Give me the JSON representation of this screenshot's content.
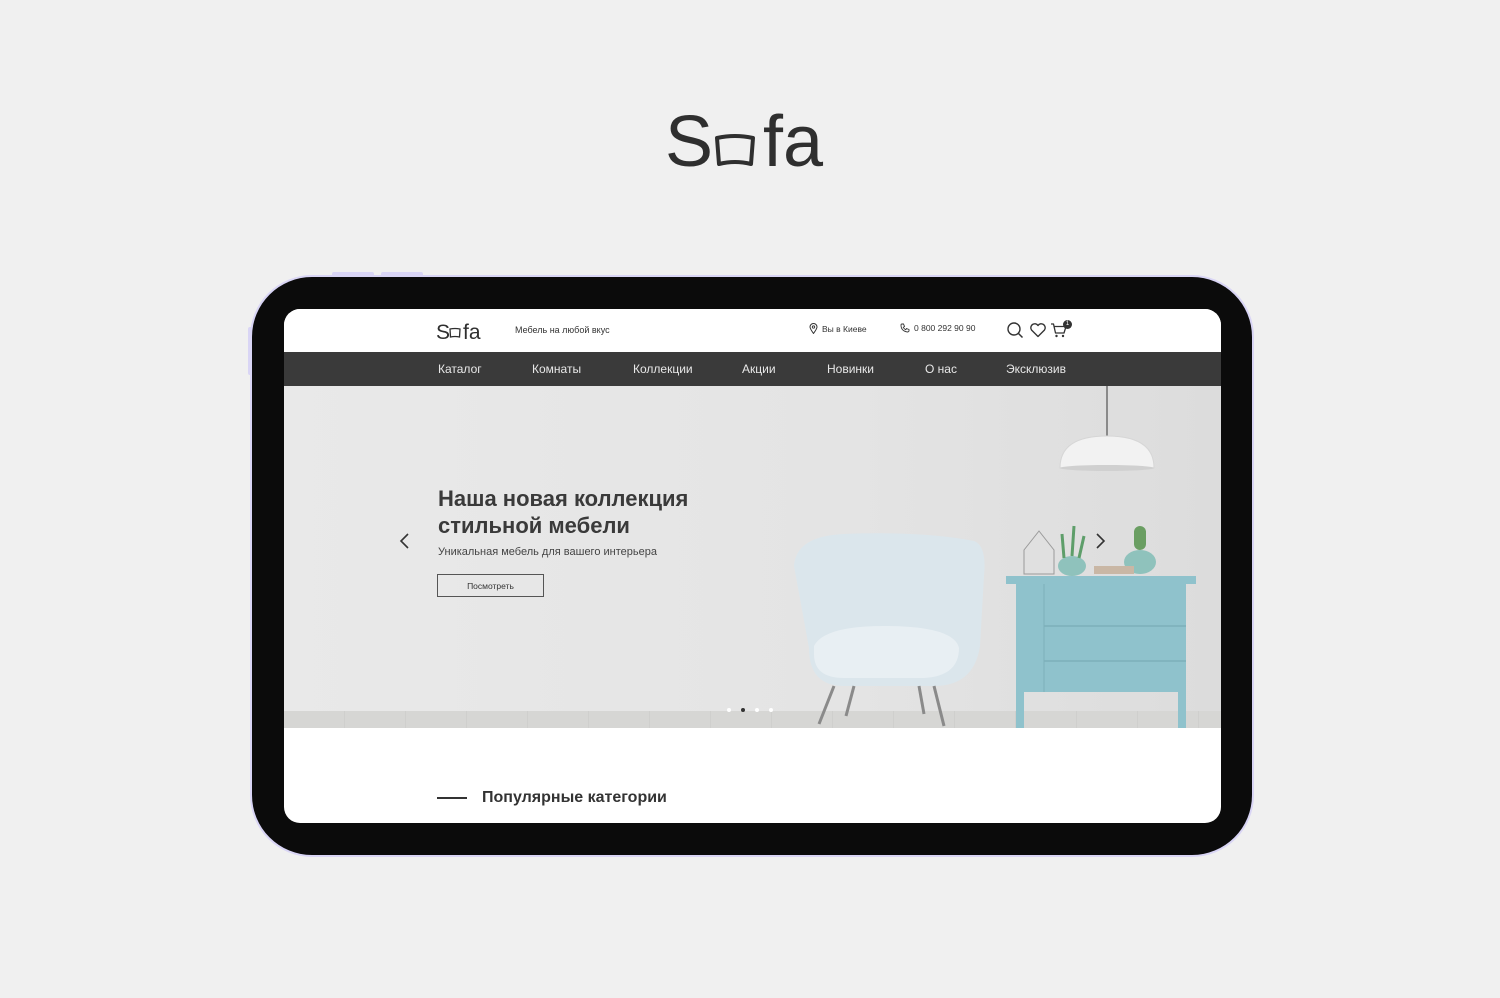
{
  "brand": {
    "name": "Sofa"
  },
  "header": {
    "tagline": "Мебель на любой вкус",
    "city": "Вы в Киеве",
    "phone": "0 800 292 90 90",
    "cart_count": "1"
  },
  "nav": {
    "items": [
      {
        "label": "Каталог"
      },
      {
        "label": "Комнаты"
      },
      {
        "label": "Коллекции"
      },
      {
        "label": "Акции"
      },
      {
        "label": "Новинки"
      },
      {
        "label": "О нас"
      },
      {
        "label": "Эксклюзив"
      }
    ]
  },
  "hero": {
    "title": "Наша новая коллекция стильной мебели",
    "subtitle": "Уникальная мебель для вашего интерьера",
    "button": "Посмотреть",
    "slides_total": 4,
    "active_slide": 2
  },
  "section": {
    "title": "Популярные категории"
  },
  "colors": {
    "page_bg": "#f0f0f0",
    "nav_bg": "#3a3a3a",
    "tablet_frame": "#0b0b0b",
    "tablet_outline": "#d9d5f5",
    "chair": "#dbe6ec",
    "dresser": "#8fc2cc"
  },
  "icons": [
    "location-icon",
    "phone-icon",
    "search-icon",
    "heart-icon",
    "cart-icon",
    "arrow-left-icon",
    "arrow-right-icon"
  ]
}
